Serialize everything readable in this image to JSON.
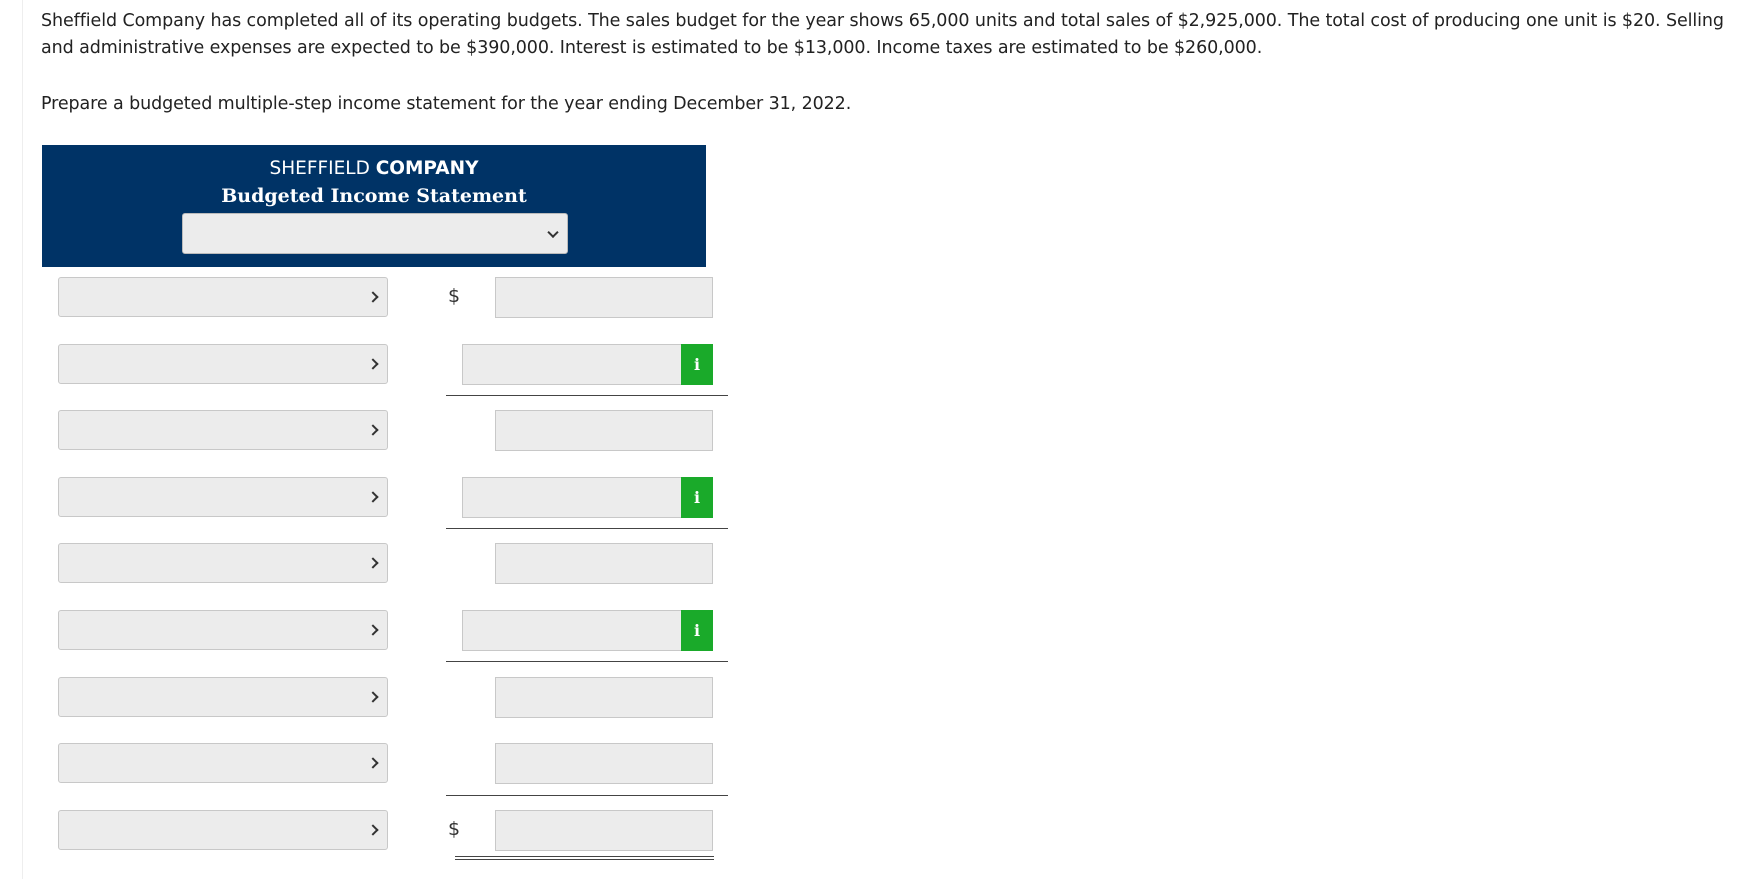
{
  "problem": {
    "text": "Sheffield Company has completed all of its operating budgets. The sales budget for the year shows 65,000 units and total sales of $2,925,000. The total cost of producing one unit is $20. Selling and administrative expenses are expected to be $390,000. Interest is estimated to be $13,000. Income taxes are estimated to be $260,000.",
    "prompt": "Prepare a budgeted multiple-step income statement for the year ending December 31, 2022."
  },
  "statement": {
    "company_part1": "SHEFFIELD",
    "company_part2": "COMPANY",
    "title": "Budgeted Income Statement",
    "period_value": ""
  },
  "currency_symbol": "$",
  "info_label": "i",
  "rows": [
    {
      "label_value": "",
      "amount_value": ""
    },
    {
      "label_value": "",
      "amount_value": ""
    },
    {
      "label_value": "",
      "amount_value": ""
    },
    {
      "label_value": "",
      "amount_value": ""
    },
    {
      "label_value": "",
      "amount_value": ""
    },
    {
      "label_value": "",
      "amount_value": ""
    },
    {
      "label_value": "",
      "amount_value": ""
    },
    {
      "label_value": "",
      "amount_value": ""
    },
    {
      "label_value": "",
      "amount_value": ""
    }
  ],
  "colors": {
    "header_bg": "#003366",
    "info_button": "#1aaa2a",
    "input_bg": "#ececec"
  }
}
